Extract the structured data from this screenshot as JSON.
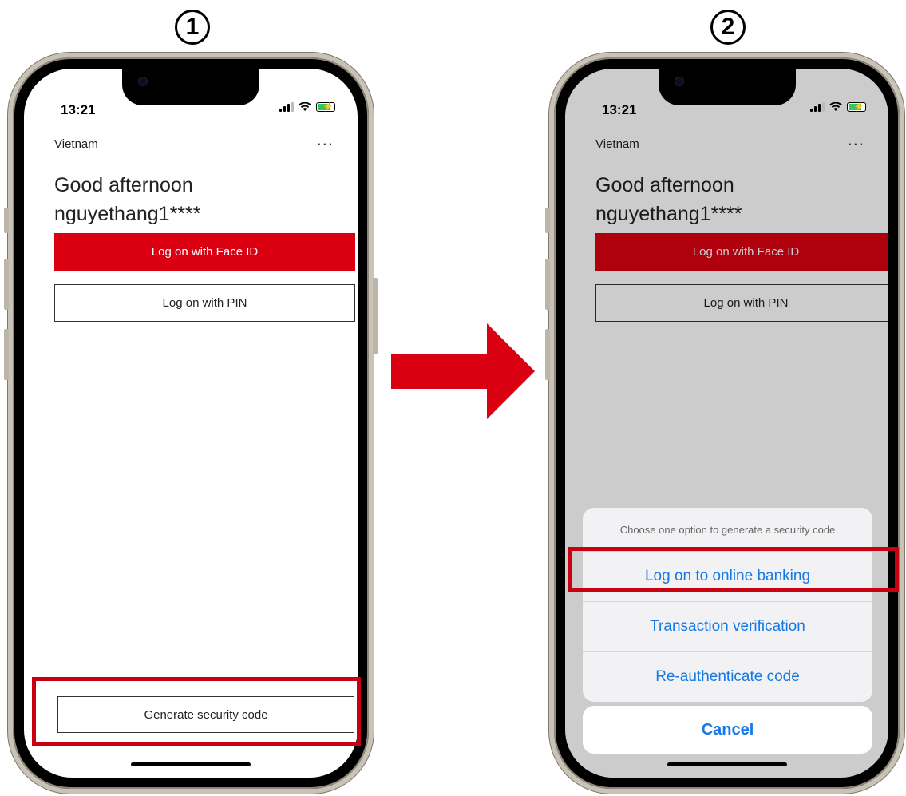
{
  "steps": [
    "1",
    "2"
  ],
  "phone1": {
    "status_time": "13:21",
    "region": "Vietnam",
    "menu": "...",
    "greeting": "Good afternoon",
    "username": "nguyethang1****",
    "face_id_button": "Log on with Face ID",
    "pin_button": "Log on with PIN",
    "generate_button": "Generate security code"
  },
  "phone2": {
    "status_time": "13:21",
    "region": "Vietnam",
    "menu": "...",
    "greeting": "Good afternoon",
    "username": "nguyethang1****",
    "face_id_button": "Log on with Face ID",
    "pin_button": "Log on with PIN",
    "sheet": {
      "title": "Choose one option to generate a security code",
      "options": [
        "Log on to online banking",
        "Transaction verification",
        "Re-authenticate code"
      ],
      "cancel": "Cancel"
    }
  },
  "colors": {
    "brand_red": "#db0011",
    "highlight_red": "#c70012",
    "ios_blue": "#1479e6"
  },
  "icons": [
    "signal-icon",
    "wifi-icon",
    "battery-charging-icon",
    "next-arrow-icon"
  ]
}
